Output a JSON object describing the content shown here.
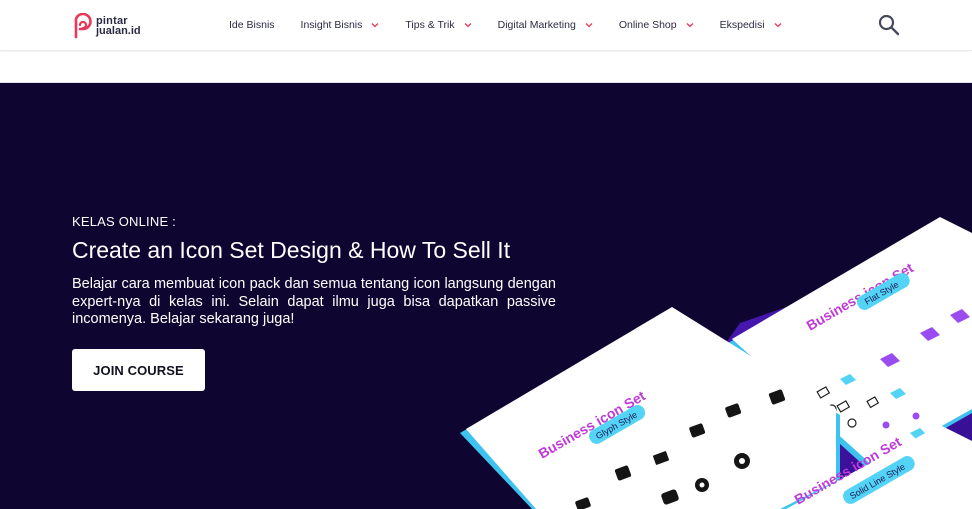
{
  "brand": {
    "logo_line1": "pintar",
    "logo_line2": "jualan.id",
    "accent_color": "#e8395a"
  },
  "nav": {
    "items": [
      {
        "label": "Ide Bisnis",
        "has_dropdown": false
      },
      {
        "label": "Insight Bisnis",
        "has_dropdown": true
      },
      {
        "label": "Tips & Trik",
        "has_dropdown": true
      },
      {
        "label": "Digital Marketing",
        "has_dropdown": true
      },
      {
        "label": "Online Shop",
        "has_dropdown": true
      },
      {
        "label": "Ekspedisi",
        "has_dropdown": true
      }
    ],
    "search_icon": "search-icon"
  },
  "hero": {
    "eyebrow": "KELAS ONLINE :",
    "title": "Create an Icon Set Design & How To Sell It",
    "description": "Belajar cara membuat icon pack dan semua tentang icon langsung dengan expert-nya di kelas ini. Selain dapat ilmu juga bisa dapatkan passive incomenya. Belajar sekarang juga!",
    "button_label": "JOIN COURSE",
    "background_color": "#0e0630",
    "illustration": {
      "card1_title": "Business icon Set",
      "card1_tag": "Glyph Style",
      "card2_title": "Business icon Set",
      "card2_tag": "Flat Style",
      "card3_title": "Business icon Set",
      "card3_tag": "Solid Line Style"
    }
  }
}
